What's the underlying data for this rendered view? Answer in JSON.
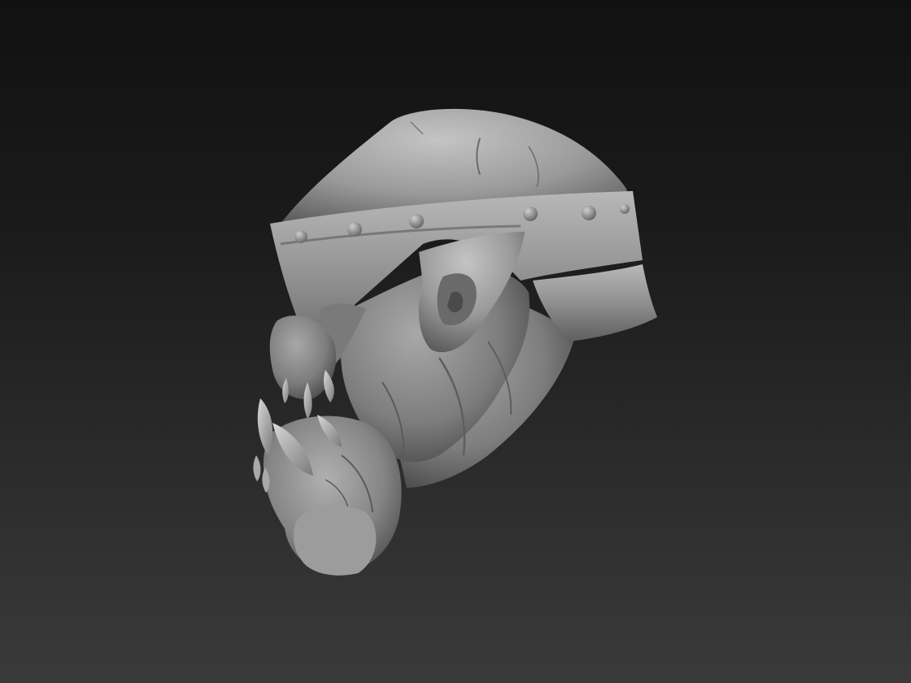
{
  "scene": {
    "subject": "",
    "colors": {
      "background_top": "#111111",
      "background_bottom": "#3a3a3a",
      "clay_light": "#bdbdbd",
      "clay_mid": "#8e8e8e",
      "clay_dark": "#4a4a4a"
    }
  }
}
